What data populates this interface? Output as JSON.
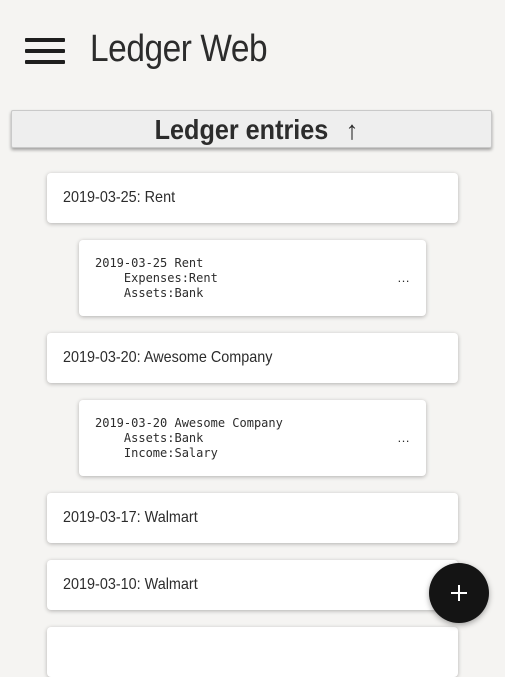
{
  "app": {
    "title": "Ledger Web",
    "menu_icon": "hamburger-menu-icon"
  },
  "section": {
    "title": "Ledger entries",
    "sort_icon": "↑"
  },
  "entries": [
    {
      "label": "2019-03-25: Rent",
      "detail": "2019-03-25 Rent\n    Expenses:Rent\n    Assets:Bank",
      "ellipsis": "…"
    },
    {
      "label": "2019-03-20: Awesome Company",
      "detail": "2019-03-20 Awesome Company\n    Assets:Bank\n    Income:Salary",
      "ellipsis": "…"
    },
    {
      "label": "2019-03-17: Walmart"
    },
    {
      "label": "2019-03-10: Walmart"
    },
    {
      "label": ""
    }
  ],
  "fab": {
    "icon": "plus-icon"
  },
  "colors": {
    "background": "#f5f4f2",
    "card": "#ffffff",
    "header_bg": "#eeeeee",
    "fab": "#141414",
    "text": "#2c2c2c"
  }
}
